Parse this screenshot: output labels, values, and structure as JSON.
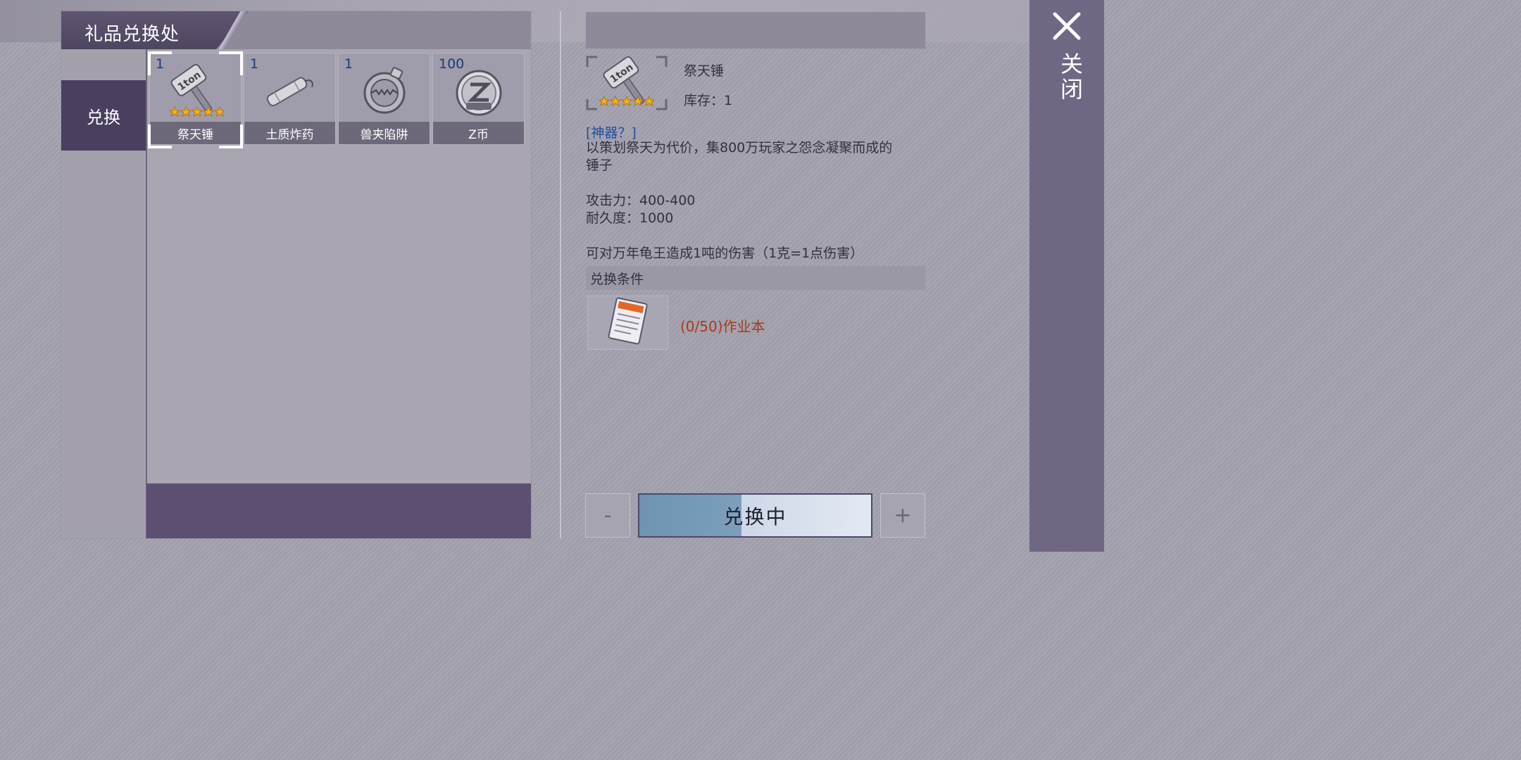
{
  "header": {
    "title": "礼品兑换处"
  },
  "sidebar": {
    "items": [
      {
        "label": "兑换",
        "selected": true
      }
    ]
  },
  "items": [
    {
      "qty": "1",
      "name": "祭天锤",
      "icon": "hammer-icon",
      "stars": 5,
      "selected": true
    },
    {
      "qty": "1",
      "name": "土质炸药",
      "icon": "dynamite-icon"
    },
    {
      "qty": "1",
      "name": "兽夹陷阱",
      "icon": "bear-trap-icon"
    },
    {
      "qty": "100",
      "name": "Z币",
      "icon": "z-coin-icon"
    }
  ],
  "detail": {
    "name": "祭天锤",
    "stock_label": "库存：1",
    "stars": 5,
    "tag": "[神器？]",
    "description": "以策划祭天为代价，集800万玩家之怨念凝聚而成的\n锤子\n\n攻击力：400-400\n耐久度：1000\n\n可对万年龟王造成1吨的伤害（1克=1点伤害）",
    "condition_header": "兑换条件",
    "condition_text": "(0/50)作业本",
    "condition_icon": "homework-book-icon"
  },
  "actions": {
    "minus": "-",
    "main": "兑换中",
    "plus": "+",
    "progress": 0.44
  },
  "close": {
    "label": "关闭"
  },
  "colors": {
    "accent": "#4a3f5f",
    "condition_red": "#a83a1e",
    "tag_blue": "#1f4fa0",
    "qty_blue": "#1d3a78"
  }
}
